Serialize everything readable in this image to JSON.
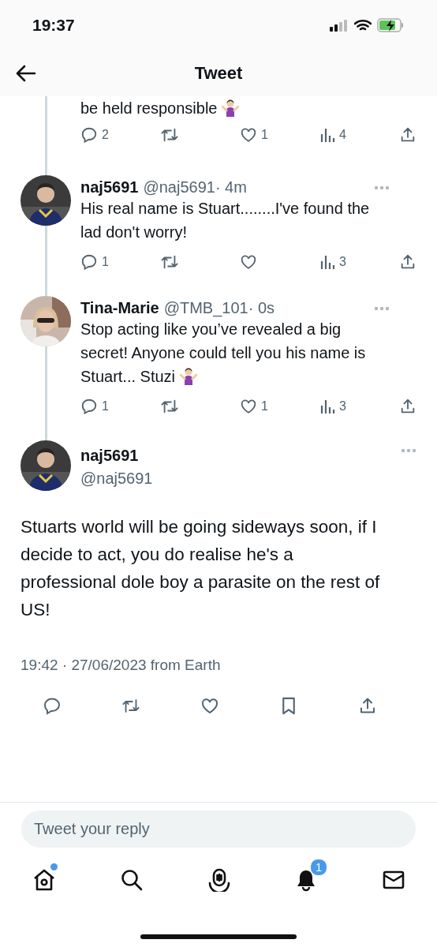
{
  "status_bar": {
    "time": "19:37"
  },
  "header": {
    "title": "Tweet"
  },
  "thread": [
    {
      "kind": "partial",
      "text": "be held responsible",
      "shrug_emoji": true,
      "stats": [
        {
          "kind": "reply",
          "count": "2"
        },
        {
          "kind": "retweet"
        },
        {
          "kind": "like",
          "count": "1"
        },
        {
          "kind": "views",
          "count": "4"
        },
        {
          "kind": "share"
        }
      ]
    },
    {
      "kind": "reply",
      "name": "naj5691",
      "handle": "@naj5691",
      "time": "· 4m",
      "text": "His real name is Stuart........I've found the lad don't worry!",
      "stats": [
        {
          "kind": "reply",
          "count": "1"
        },
        {
          "kind": "retweet"
        },
        {
          "kind": "like"
        },
        {
          "kind": "views",
          "count": "3"
        },
        {
          "kind": "share"
        }
      ]
    },
    {
      "kind": "reply",
      "name": "Tina-Marie",
      "handle": "@TMB_101",
      "time": "· 0s",
      "text": "Stop acting like you’ve revealed a big secret! Anyone could tell you his name is Stuart... Stuzi",
      "shrug_emoji": true,
      "stats": [
        {
          "kind": "reply",
          "count": "1"
        },
        {
          "kind": "retweet"
        },
        {
          "kind": "like",
          "count": "1"
        },
        {
          "kind": "views",
          "count": "3"
        },
        {
          "kind": "share"
        }
      ]
    }
  ],
  "main_tweet": {
    "name": "naj5691",
    "handle": "@naj5691",
    "text": "Stuarts world will be going sideways soon, if I decide to act, you do realise he's a professional dole boy a parasite on the rest of US!",
    "meta": "19:42 · 27/06/2023 from Earth",
    "actions": [
      {
        "kind": "reply"
      },
      {
        "kind": "retweet"
      },
      {
        "kind": "like"
      },
      {
        "kind": "bookmark"
      },
      {
        "kind": "share"
      }
    ]
  },
  "reply_box": {
    "placeholder": "Tweet your reply"
  },
  "nav": [
    {
      "kind": "home",
      "unread": true
    },
    {
      "kind": "search",
      "unread": false
    },
    {
      "kind": "spaces",
      "unread": false
    },
    {
      "kind": "notifications",
      "badge": "1"
    },
    {
      "kind": "messages",
      "unread": false
    }
  ]
}
